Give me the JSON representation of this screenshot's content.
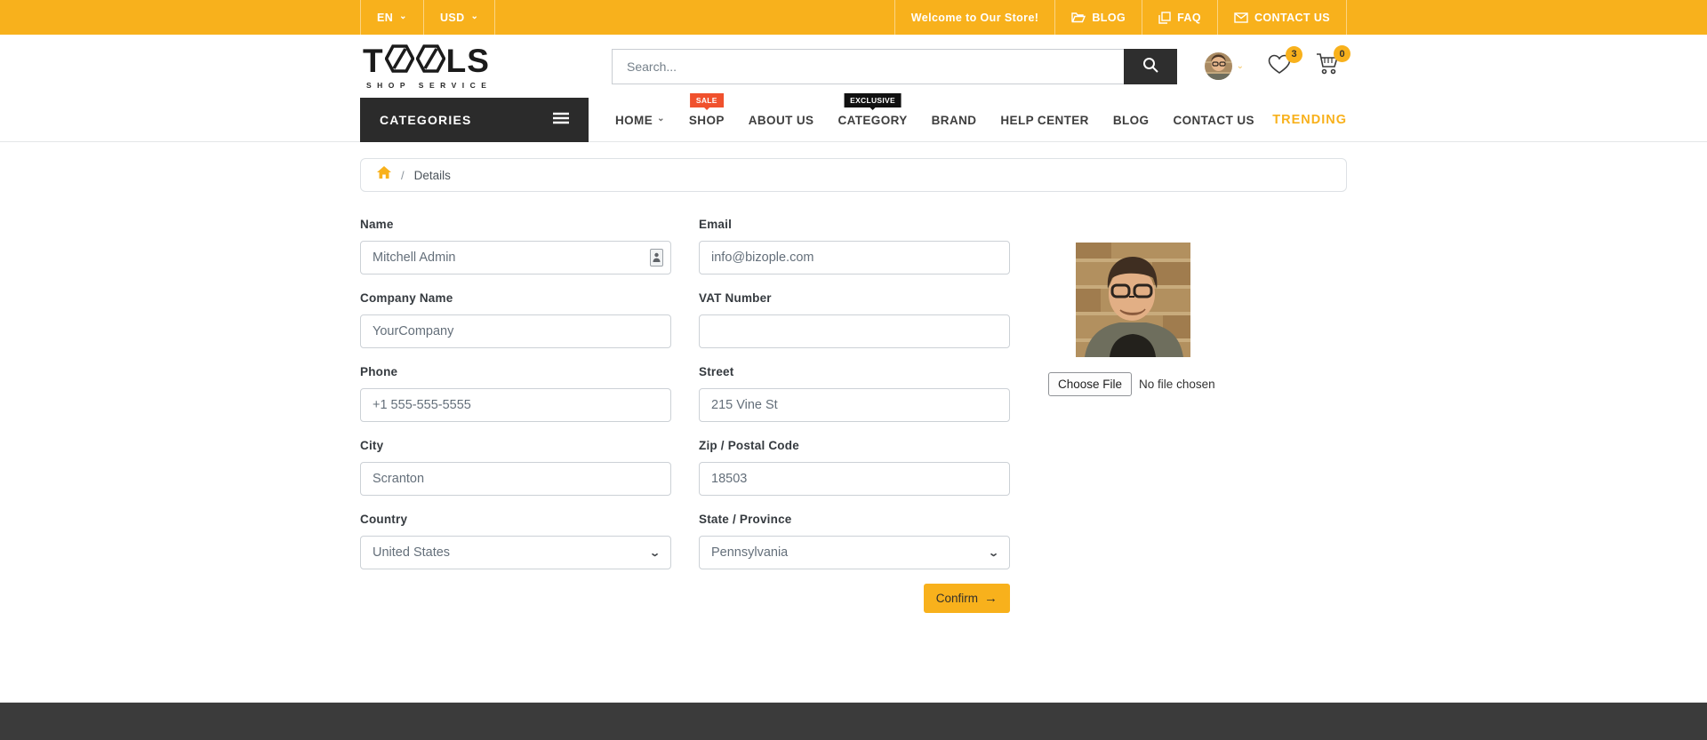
{
  "topbar": {
    "language": "EN",
    "currency": "USD",
    "welcome": "Welcome to Our Store!",
    "links": [
      {
        "icon": "folder-icon",
        "label": "BLOG"
      },
      {
        "icon": "copy-icon",
        "label": "FAQ"
      },
      {
        "icon": "mail-icon",
        "label": "CONTACT US"
      }
    ]
  },
  "header": {
    "logo_t": "T",
    "logo_ls": "LS",
    "logo_subtitle": "SHOP SERVICE",
    "search_placeholder": "Search...",
    "wishlist_count": "3",
    "cart_count": "0"
  },
  "nav": {
    "categories_label": "CATEGORIES",
    "items": [
      {
        "label": "HOME"
      },
      {
        "label": "SHOP",
        "badge": "SALE"
      },
      {
        "label": "ABOUT US"
      },
      {
        "label": "CATEGORY",
        "badge": "EXCLUSIVE"
      },
      {
        "label": "BRAND"
      },
      {
        "label": "HELP CENTER"
      },
      {
        "label": "BLOG"
      },
      {
        "label": "CONTACT US"
      }
    ],
    "trending_label": "TRENDING"
  },
  "breadcrumb": {
    "separator": "/",
    "current": "Details"
  },
  "form": {
    "fields": [
      {
        "label": "Name",
        "value": "Mitchell Admin"
      },
      {
        "label": "Email",
        "value": "info@bizople.com"
      },
      {
        "label": "Company Name",
        "value": "YourCompany"
      },
      {
        "label": "VAT Number",
        "value": ""
      },
      {
        "label": "Phone",
        "value": "+1 555-555-5555"
      },
      {
        "label": "Street",
        "value": "215 Vine St"
      },
      {
        "label": "City",
        "value": "Scranton"
      },
      {
        "label": "Zip / Postal Code",
        "value": "18503"
      },
      {
        "label": "Country",
        "value": "United States"
      },
      {
        "label": "State / Province",
        "value": "Pennsylvania"
      }
    ],
    "file_upload": {
      "button": "Choose File",
      "status": "No file chosen"
    },
    "confirm_label": "Confirm",
    "confirm_arrow": "→"
  },
  "icons": {
    "chevron_down": "⌄",
    "breadcrumb_home": "home-icon"
  },
  "colors": {
    "accent_yellow": "#f8b11c",
    "badge_red": "#f0512d",
    "badge_black": "#111111",
    "nav_dark": "#2b2b2b",
    "footer_dark": "#3b3b3b"
  }
}
